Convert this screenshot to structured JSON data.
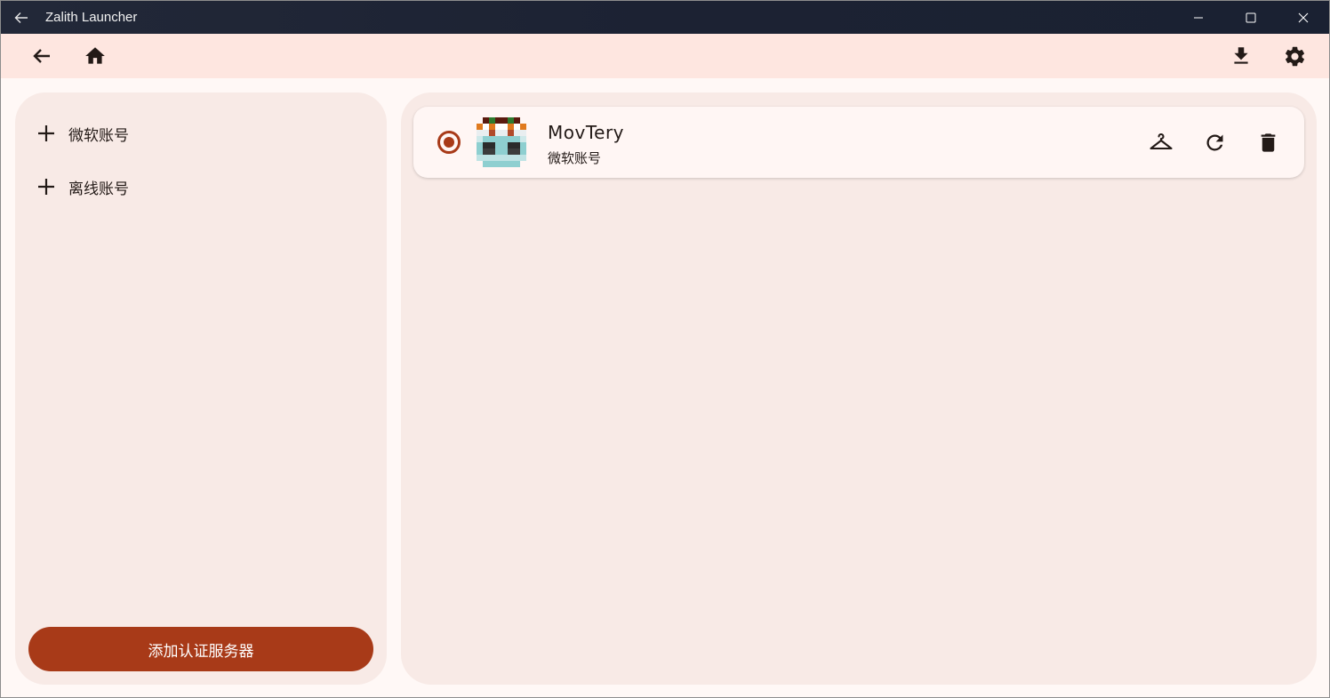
{
  "window": {
    "title": "Zalith Launcher"
  },
  "left_panel": {
    "add_items": [
      {
        "label": "微软账号"
      },
      {
        "label": "离线账号"
      }
    ],
    "auth_button_label": "添加认证服务器"
  },
  "accounts": [
    {
      "name": "MovTery",
      "type": "微软账号",
      "selected": true
    }
  ],
  "colors": {
    "accent": "#a83a18",
    "appbar": "#fee6e0",
    "panel": "#f8eae6",
    "titlebar": "#1c2233"
  },
  "icons": {
    "titlebar_back": "arrow-left-icon",
    "nav_back": "arrow-left-icon",
    "home": "home-icon",
    "download": "download-icon",
    "settings": "gear-icon",
    "skin": "hanger-icon",
    "refresh": "refresh-icon",
    "delete": "trash-icon"
  }
}
